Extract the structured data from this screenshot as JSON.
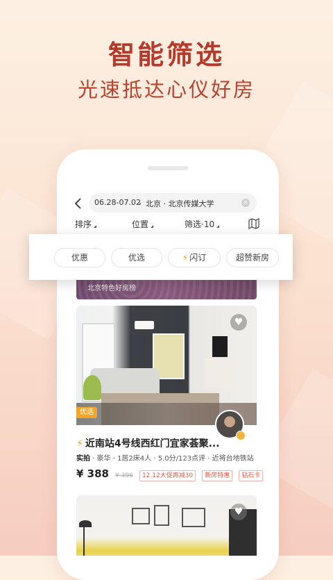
{
  "hero": {
    "title": "智能筛选",
    "subtitle": "光速抵达心仪好房"
  },
  "search": {
    "dates": "06.28-07.02",
    "location": "北京 · 北京传媒大学",
    "back_icon": "chevron-left-icon",
    "clear_icon": "clear-circle-icon"
  },
  "filters": {
    "items": [
      "排序",
      "位置",
      "筛选·10"
    ],
    "map_icon": "map-icon"
  },
  "promo_strip": {
    "text": "北京特色好房榜"
  },
  "chips": [
    {
      "label": "优惠",
      "active": false
    },
    {
      "label": "优选",
      "active": false
    },
    {
      "label": "闪订",
      "active": true
    },
    {
      "label": "超赞新房",
      "active": false
    }
  ],
  "listing": {
    "tag": "优选",
    "title": "近南站4号线西红门宜家荟聚...",
    "meta_prefix": "实拍",
    "meta": " · 豪华 · 1居2床4人 · 5.0分/123点评 · 近将台地铁站",
    "price": "¥ 388",
    "original_price": "¥ 396",
    "badges": [
      "12.12大促再减30",
      "新房特惠",
      "钻石卡"
    ]
  },
  "colors": {
    "accent": "#b43a2c",
    "bolt": "#f4a11c",
    "promo_text": "#e45b4a"
  }
}
